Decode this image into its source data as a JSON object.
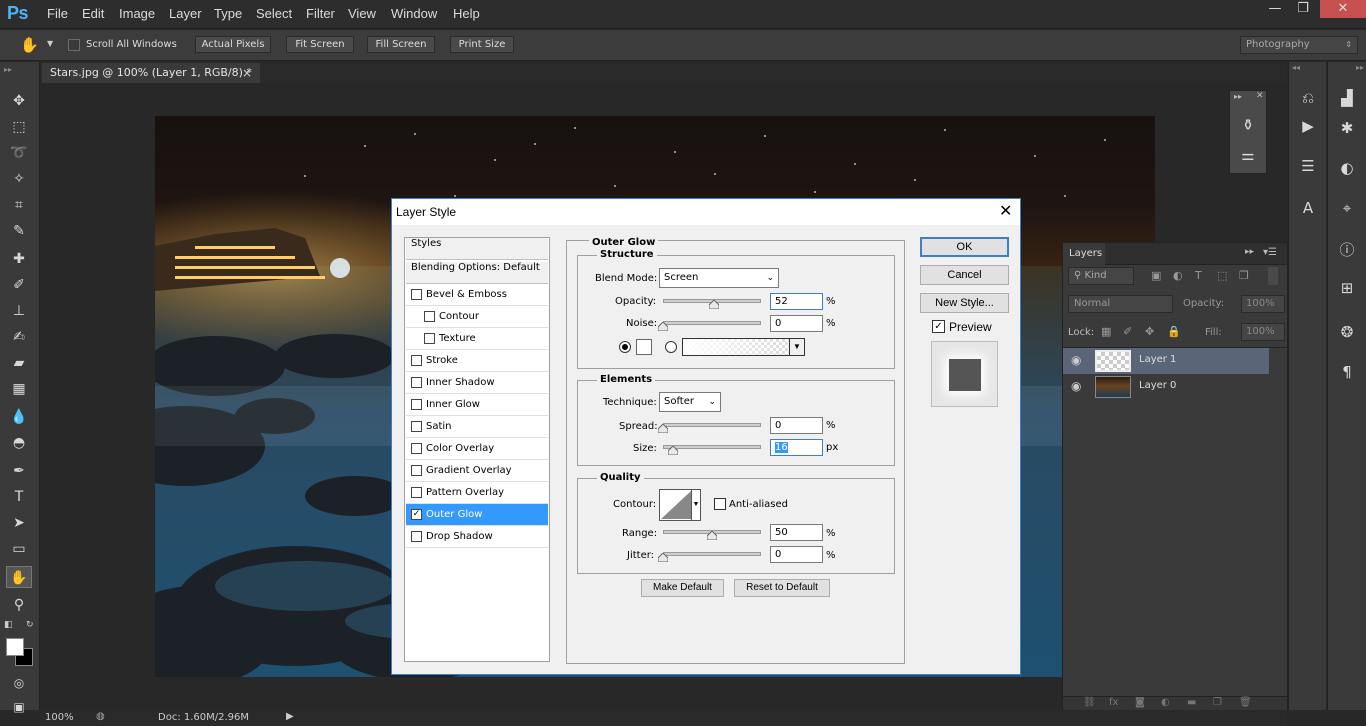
{
  "app": {
    "logo": "Ps",
    "menu": [
      "File",
      "Edit",
      "Image",
      "Layer",
      "Type",
      "Select",
      "Filter",
      "View",
      "Window",
      "Help"
    ],
    "window_controls": {
      "minimize": "—",
      "restore": "❐",
      "close": "✕"
    }
  },
  "options_bar": {
    "scroll_all_label": "Scroll All Windows",
    "buttons": [
      "Actual Pixels",
      "Fit Screen",
      "Fill Screen",
      "Print Size"
    ],
    "workspace": "Photography"
  },
  "document": {
    "tab_title": "Stars.jpg @ 100% (Layer 1, RGB/8) *",
    "close": "×"
  },
  "status_bar": {
    "zoom": "100%",
    "doc_info": "Doc: 1.60M/2.96M"
  },
  "layers_panel": {
    "title": "Layers",
    "filter_kind": "Kind",
    "blend_mode": "Normal",
    "opacity_label": "Opacity:",
    "opacity_value": "100%",
    "lock_label": "Lock:",
    "fill_label": "Fill:",
    "fill_value": "100%",
    "layers": [
      {
        "name": "Layer 1",
        "selected": true
      },
      {
        "name": "Layer 0",
        "selected": false
      }
    ]
  },
  "dialog": {
    "title": "Layer Style",
    "close": "✕",
    "styles_header": "Styles",
    "blending_options": "Blending Options: Default",
    "style_items": [
      {
        "label": "Bevel & Emboss",
        "checked": false,
        "indent": false
      },
      {
        "label": "Contour",
        "checked": false,
        "indent": true
      },
      {
        "label": "Texture",
        "checked": false,
        "indent": true
      },
      {
        "label": "Stroke",
        "checked": false,
        "indent": false
      },
      {
        "label": "Inner Shadow",
        "checked": false,
        "indent": false
      },
      {
        "label": "Inner Glow",
        "checked": false,
        "indent": false
      },
      {
        "label": "Satin",
        "checked": false,
        "indent": false
      },
      {
        "label": "Color Overlay",
        "checked": false,
        "indent": false
      },
      {
        "label": "Gradient Overlay",
        "checked": false,
        "indent": false
      },
      {
        "label": "Pattern Overlay",
        "checked": false,
        "indent": false
      },
      {
        "label": "Outer Glow",
        "checked": true,
        "indent": false,
        "selected": true
      },
      {
        "label": "Drop Shadow",
        "checked": false,
        "indent": false
      }
    ],
    "section_title": "Outer Glow",
    "structure": {
      "title": "Structure",
      "blend_mode_label": "Blend Mode:",
      "blend_mode_value": "Screen",
      "opacity_label": "Opacity:",
      "opacity_value": "52",
      "noise_label": "Noise:",
      "noise_value": "0",
      "percent": "%"
    },
    "elements": {
      "title": "Elements",
      "technique_label": "Technique:",
      "technique_value": "Softer",
      "spread_label": "Spread:",
      "spread_value": "0",
      "size_label": "Size:",
      "size_value": "16",
      "percent": "%",
      "px": "px"
    },
    "quality": {
      "title": "Quality",
      "contour_label": "Contour:",
      "anti_aliased_label": "Anti-aliased",
      "range_label": "Range:",
      "range_value": "50",
      "jitter_label": "Jitter:",
      "jitter_value": "0",
      "percent": "%"
    },
    "make_default": "Make Default",
    "reset_default": "Reset to Default",
    "ok": "OK",
    "cancel": "Cancel",
    "new_style": "New Style...",
    "preview_label": "Preview",
    "preview_checked": true,
    "slider_levels": {
      "opacity": 0.52,
      "noise": 0,
      "spread": 0,
      "size": 0.1,
      "range": 0.5,
      "jitter": 0
    }
  }
}
